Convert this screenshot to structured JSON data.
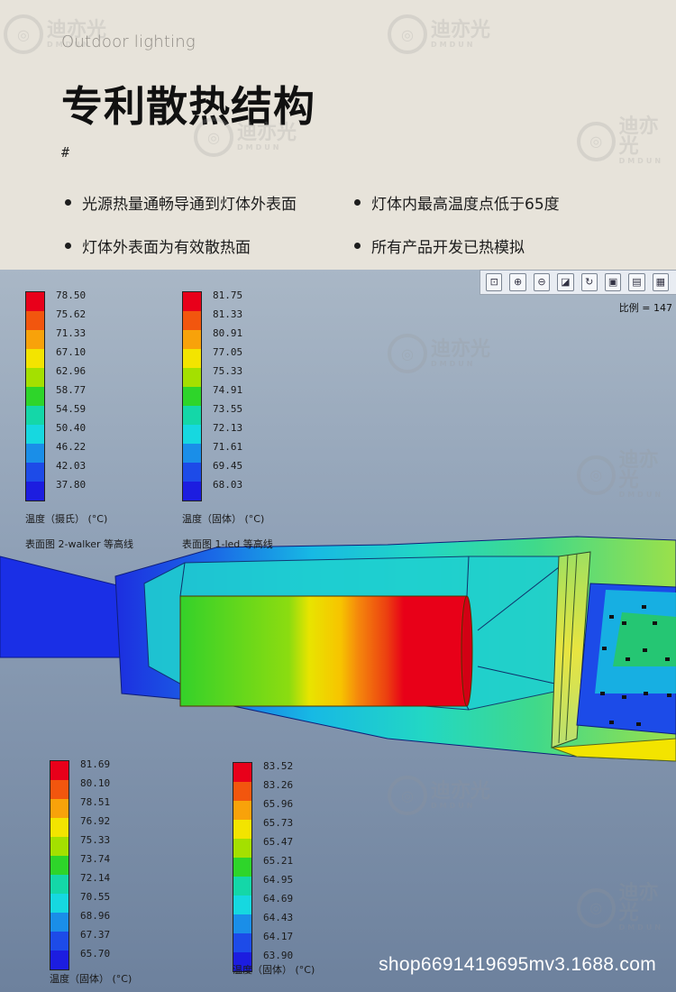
{
  "header": {
    "subtitle": "Outdoor lighting",
    "title": "专利散热结构",
    "hash": "#",
    "bullets": [
      "光源热量通畅导通到灯体外表面",
      "灯体内最高温度点低于65度",
      "灯体外表面为有效散热面",
      "所有产品开发已热模拟"
    ]
  },
  "watermark": {
    "brand": "迪亦光",
    "sub": "DMDUN"
  },
  "colors": {
    "scale": [
      "#e8001a",
      "#f2560e",
      "#f8a20a",
      "#f3e400",
      "#a4e000",
      "#2ed52a",
      "#14d7a8",
      "#16d8e0",
      "#1a8ee8",
      "#1d4be8",
      "#1c1de0"
    ]
  },
  "toolbar": {
    "icons": [
      "zoom-fit-icon",
      "zoom-in-icon",
      "zoom-out-icon",
      "box-zoom-icon",
      "rotate-icon",
      "view-cube-icon",
      "section-icon",
      "display-icon"
    ],
    "readout": "比例 = 147"
  },
  "legends": [
    {
      "values": [
        "78.50",
        "75.62",
        "71.33",
        "67.10",
        "62.96",
        "58.77",
        "54.59",
        "50.40",
        "46.22",
        "42.03",
        "37.80"
      ],
      "caption1": "温度（摄氏） (°C)",
      "caption2": "表面图 2-walker 等高线"
    },
    {
      "values": [
        "81.75",
        "81.33",
        "80.91",
        "77.05",
        "75.33",
        "74.91",
        "73.55",
        "72.13",
        "71.61",
        "69.45",
        "68.03"
      ],
      "caption1": "温度（固体） (°C)",
      "caption2": "表面图 1-led 等高线"
    },
    {
      "values": [
        "81.69",
        "80.10",
        "78.51",
        "76.92",
        "75.33",
        "73.74",
        "72.14",
        "70.55",
        "68.96",
        "67.37",
        "65.70"
      ],
      "caption1": "温度（固体） (°C)",
      "caption2": ""
    },
    {
      "values": [
        "83.52",
        "83.26",
        "65.96",
        "65.73",
        "65.47",
        "65.21",
        "64.95",
        "64.69",
        "64.43",
        "64.17",
        "63.90"
      ],
      "caption1": "温度（固体） (°C)",
      "caption2": ""
    }
  ],
  "url": "shop6691419695mv3.1688.com"
}
